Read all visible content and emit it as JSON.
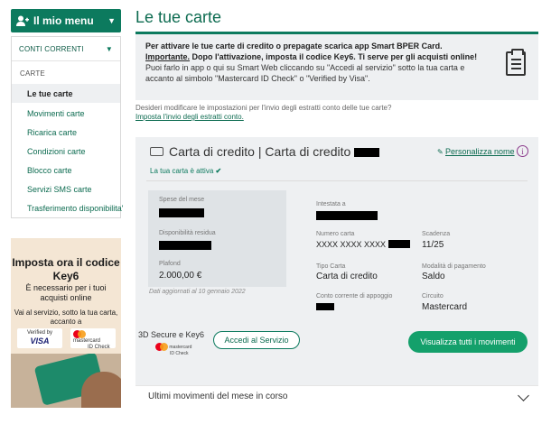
{
  "sidebar": {
    "menu_label": "Il mio menu",
    "section_label": "CONTI CORRENTI",
    "group_label": "CARTE",
    "items": [
      {
        "label": "Le tue carte"
      },
      {
        "label": "Movimenti carte"
      },
      {
        "label": "Ricarica carte"
      },
      {
        "label": "Condizioni carte"
      },
      {
        "label": "Blocco carte"
      },
      {
        "label": "Servizi SMS carte"
      },
      {
        "label": "Trasferimento disponibilita'"
      }
    ]
  },
  "banner": {
    "title": "Imposta ora il codice Key6",
    "subtitle": "È necessario per i tuoi acquisti online",
    "text": "Vai al servizio, sotto la tua carta, accanto a",
    "visa_label": "Verified by",
    "visa_brand": "VISA",
    "mc_label": "mastercard",
    "mc_sub": "ID Check"
  },
  "main": {
    "title": "Le tue carte",
    "info": {
      "line1": "Per attivare le tue carte di credito o prepagate scarica app Smart BPER Card.",
      "line2_u": "Importante.",
      "line2": " Dopo l'attivazione, imposta il codice Key6. Ti serve per gli acquisti online!",
      "line3": "Puoi farlo in app o qui su Smart Web cliccando su \"Accedi al servizio\" sotto la tua carta e accanto al simbolo \"Mastercard ID Check\" o \"Verified by Visa\"."
    },
    "estratti_question": "Desideri modificare le impostazioni per l'invio degli estratti conto delle tue carte?",
    "estratti_link": "Imposta l'invio degli estratti conto.",
    "card": {
      "title": "Carta di credito | Carta di credito",
      "personalizza": "Personalizza nome",
      "status": "La tua carta è attiva",
      "spese_label": "Spese del mese",
      "disponibilita_label": "Disponibilità residua",
      "plafond_label": "Plafond",
      "plafond_value": "2.000,00 €",
      "updated": "Dati aggiornati al 10 gennaio 2022",
      "intestata_label": "Intestata a",
      "numero_label": "Numero carta",
      "numero_value": "XXXX XXXX XXXX",
      "scadenza_label": "Scadenza",
      "scadenza_value": "11/25",
      "tipo_label": "Tipo Carta",
      "tipo_value": "Carta di credito",
      "pagamento_label": "Modalità di pagamento",
      "pagamento_value": "Saldo",
      "conto_label": "Conto corrente di appoggio",
      "circuito_label": "Circuito",
      "circuito_value": "Mastercard",
      "secure_label": "3D Secure e Key6",
      "mc_label": "mastercard",
      "mc_sub": "ID Check",
      "accedi_button": "Accedi al Servizio",
      "movimenti_button": "Visualizza tutti i movimenti"
    },
    "ultimi": "Ultimi movimenti del mese in corso"
  }
}
